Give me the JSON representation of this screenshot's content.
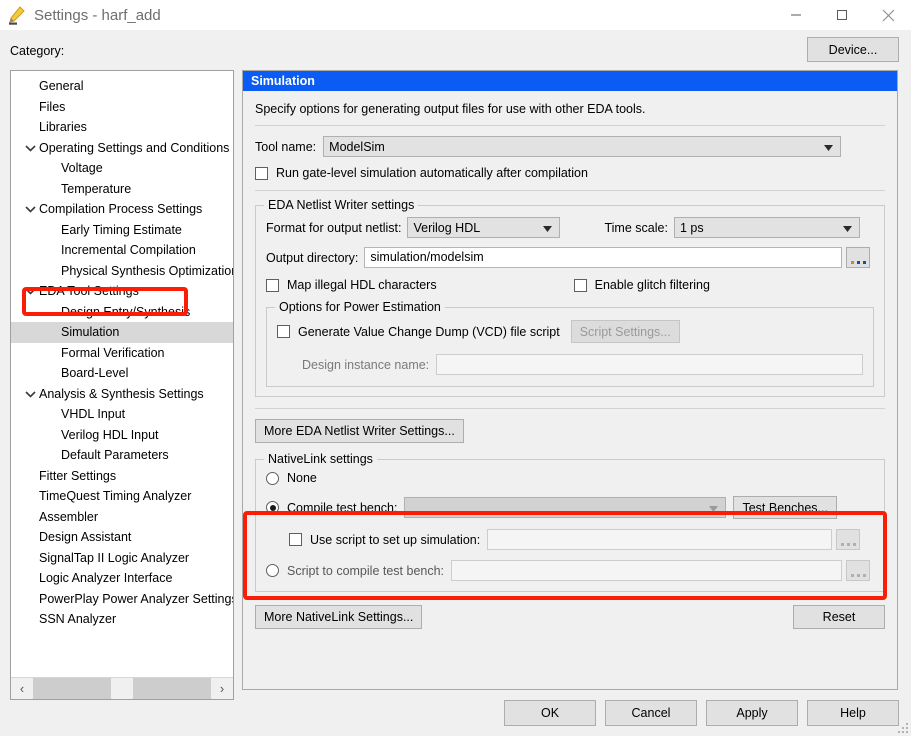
{
  "window": {
    "title": "Settings - harf_add",
    "icon": "pencil-icon",
    "minimize": "—",
    "maximize": "❑",
    "close": "✕"
  },
  "toolbar": {
    "category_label": "Category:",
    "device_button": "Device..."
  },
  "tree": {
    "items": [
      {
        "label": "General",
        "level": 0,
        "twisty": "none",
        "selected": false
      },
      {
        "label": "Files",
        "level": 0,
        "twisty": "none",
        "selected": false
      },
      {
        "label": "Libraries",
        "level": 0,
        "twisty": "none",
        "selected": false
      },
      {
        "label": "Operating Settings and Conditions",
        "level": 0,
        "twisty": "expanded",
        "selected": false
      },
      {
        "label": "Voltage",
        "level": 1,
        "twisty": "none",
        "selected": false
      },
      {
        "label": "Temperature",
        "level": 1,
        "twisty": "none",
        "selected": false
      },
      {
        "label": "Compilation Process Settings",
        "level": 0,
        "twisty": "expanded",
        "selected": false
      },
      {
        "label": "Early Timing Estimate",
        "level": 1,
        "twisty": "none",
        "selected": false
      },
      {
        "label": "Incremental Compilation",
        "level": 1,
        "twisty": "none",
        "selected": false
      },
      {
        "label": "Physical Synthesis Optimization",
        "level": 1,
        "twisty": "none",
        "selected": false
      },
      {
        "label": "EDA Tool Settings",
        "level": 0,
        "twisty": "expanded",
        "selected": false
      },
      {
        "label": "Design Entry/Synthesis",
        "level": 1,
        "twisty": "none",
        "selected": false
      },
      {
        "label": "Simulation",
        "level": 1,
        "twisty": "none",
        "selected": true
      },
      {
        "label": "Formal Verification",
        "level": 1,
        "twisty": "none",
        "selected": false
      },
      {
        "label": "Board-Level",
        "level": 1,
        "twisty": "none",
        "selected": false
      },
      {
        "label": "Analysis & Synthesis Settings",
        "level": 0,
        "twisty": "expanded",
        "selected": false
      },
      {
        "label": "VHDL Input",
        "level": 1,
        "twisty": "none",
        "selected": false
      },
      {
        "label": "Verilog HDL Input",
        "level": 1,
        "twisty": "none",
        "selected": false
      },
      {
        "label": "Default Parameters",
        "level": 1,
        "twisty": "none",
        "selected": false
      },
      {
        "label": "Fitter Settings",
        "level": 0,
        "twisty": "none",
        "selected": false
      },
      {
        "label": "TimeQuest Timing Analyzer",
        "level": 0,
        "twisty": "none",
        "selected": false
      },
      {
        "label": "Assembler",
        "level": 0,
        "twisty": "none",
        "selected": false
      },
      {
        "label": "Design Assistant",
        "level": 0,
        "twisty": "none",
        "selected": false
      },
      {
        "label": "SignalTap II Logic Analyzer",
        "level": 0,
        "twisty": "none",
        "selected": false
      },
      {
        "label": "Logic Analyzer Interface",
        "level": 0,
        "twisty": "none",
        "selected": false
      },
      {
        "label": "PowerPlay Power Analyzer Settings",
        "level": 0,
        "twisty": "none",
        "selected": false
      },
      {
        "label": "SSN Analyzer",
        "level": 0,
        "twisty": "none",
        "selected": false
      }
    ],
    "scroll_left_arrow": "‹",
    "scroll_right_arrow": "›"
  },
  "panel": {
    "header": "Simulation",
    "description": "Specify options for generating output files for use with other EDA tools.",
    "tool_name_label": "Tool name:",
    "tool_name_value": "ModelSim",
    "run_gate_level_label": "Run gate-level simulation automatically after compilation",
    "run_gate_level_checked": false
  },
  "netlist_writer": {
    "group_title": "EDA Netlist Writer settings",
    "format_label": "Format for output netlist:",
    "format_value": "Verilog HDL",
    "time_scale_label": "Time scale:",
    "time_scale_value": "1 ps",
    "output_dir_label": "Output directory:",
    "output_dir_value": "simulation/modelsim",
    "browse_button": "...",
    "map_illegal_label": "Map illegal HDL characters",
    "map_illegal_checked": false,
    "glitch_filter_label": "Enable glitch filtering",
    "glitch_filter_checked": false,
    "power_group_title": "Options for Power Estimation",
    "vcd_label": "Generate Value Change Dump (VCD) file script",
    "vcd_checked": false,
    "script_settings_button": "Script Settings...",
    "design_instance_label": "Design instance name:",
    "design_instance_value": ""
  },
  "more_eda_button": "More EDA Netlist Writer Settings...",
  "nativelink": {
    "group_title": "NativeLink settings",
    "option_none": "None",
    "option_compile_test_bench": "Compile test bench:",
    "compile_test_bench_value": "",
    "test_benches_button": "Test Benches...",
    "use_script_label": "Use script to set up simulation:",
    "use_script_checked": false,
    "use_script_value": "",
    "use_script_browse": "...",
    "option_script_compile": "Script to compile test bench:",
    "script_compile_value": "",
    "script_compile_browse": "...",
    "selected_option": "compile_test_bench"
  },
  "more_nativelink_button": "More NativeLink Settings...",
  "reset_button": "Reset",
  "dialog_buttons": [
    {
      "label": "OK",
      "name": "ok-button"
    },
    {
      "label": "Cancel",
      "name": "cancel-button"
    },
    {
      "label": "Apply",
      "name": "apply-button"
    },
    {
      "label": "Help",
      "name": "help-button"
    }
  ],
  "colors": {
    "header_blue": "#0b5cf5",
    "annotation_red": "#fb1d05",
    "window_bg": "#f0f0f0",
    "selection_gray": "#d8d8d8"
  }
}
